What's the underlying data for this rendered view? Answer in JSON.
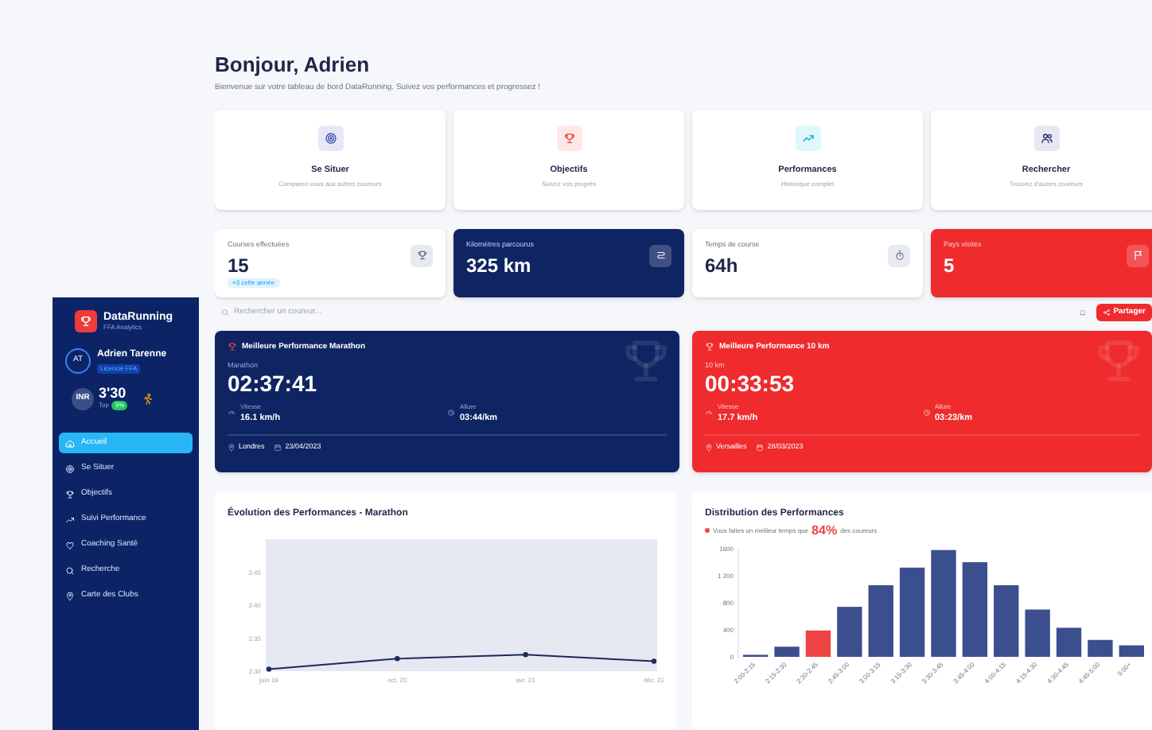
{
  "sidebar": {
    "brand": "DataRunning",
    "brand_sub": "FFA Analytics",
    "user": {
      "initials": "AT",
      "name": "Adrien Tarenne",
      "badge": "Licencié FFA"
    },
    "rating": {
      "label": "INR",
      "value": "3'30",
      "rank_label": "Top",
      "rank": "5%"
    },
    "items": [
      {
        "label": "Accueil",
        "selected": true
      },
      {
        "label": "Se Situer",
        "selected": false
      },
      {
        "label": "Objectifs",
        "selected": false
      },
      {
        "label": "Suivi Performance",
        "selected": false
      },
      {
        "label": "Coaching Santé",
        "selected": false
      },
      {
        "label": "Recherche",
        "selected": false
      },
      {
        "label": "Carte des Clubs",
        "selected": false
      }
    ]
  },
  "header": {
    "title": "Bonjour, Adrien",
    "subtitle": "Bienvenue sur votre tableau de bord DataRunning. Suivez vos performances et progressez !"
  },
  "features": [
    {
      "title": "Se Situer",
      "subtitle": "Comparez-vous aux autres coureurs"
    },
    {
      "title": "Objectifs",
      "subtitle": "Suivez vos progrès"
    },
    {
      "title": "Performances",
      "subtitle": "Historique complet"
    },
    {
      "title": "Rechercher",
      "subtitle": "Trouvez d'autres coureurs"
    }
  ],
  "stats": [
    {
      "kind": "light",
      "label": "Courses effectuées",
      "value": "15",
      "badge": "+3 cette année"
    },
    {
      "kind": "navy",
      "label": "Kilomètres parcourus",
      "value": "325 km"
    },
    {
      "kind": "light",
      "label": "Temps de course",
      "value": "64h"
    },
    {
      "kind": "red",
      "label": "Pays visités",
      "value": "5"
    }
  ],
  "search": {
    "placeholder": "Rechercher un coureur...",
    "share_button": "Partager"
  },
  "records": [
    {
      "kind": "navy",
      "title": "Meilleure Performance Marathon",
      "distance": "Marathon",
      "time": "02:37:41",
      "speed_label": "Vitesse",
      "speed": "16.1 km/h",
      "pace_label": "Allure",
      "pace": "03:44/km",
      "place": "Londres",
      "date": "23/04/2023"
    },
    {
      "kind": "red",
      "title": "Meilleure Performance 10 km",
      "distance": "10 km",
      "time": "00:33:53",
      "speed_label": "Vitesse",
      "speed": "17.7 km/h",
      "pace_label": "Allure",
      "pace": "03:23/km",
      "place": "Versailles",
      "date": "28/03/2023"
    }
  ],
  "evolution": {
    "chart_data": {
      "type": "line",
      "title": "Évolution des Performances - Marathon",
      "categories": [
        "juin 19",
        "oct. 20",
        "avr. 21",
        "déc. 22"
      ],
      "series": [
        {
          "color": "#1e2a5a",
          "marker": true,
          "values": [
            150.3,
            151.9,
            152.5,
            151.5
          ]
        }
      ],
      "yticks": [
        {
          "value": 150,
          "label": "2:30"
        },
        {
          "value": 155,
          "label": "2:35"
        },
        {
          "value": 160,
          "label": "2:40"
        },
        {
          "value": 165,
          "label": "2:45"
        }
      ],
      "ylim": [
        150,
        170
      ]
    }
  },
  "distribution": {
    "note_before": "Vous faites un meilleur temps que",
    "note_value": "84%",
    "note_after": "des coureurs",
    "chart_data": {
      "type": "bar",
      "title": "Distribution des Performances",
      "categories": [
        "2:00-2:15",
        "2:15-2:30",
        "2:30-2:45",
        "2:45-3:00",
        "3:00-3:15",
        "3:15-3:30",
        "3:30-3:45",
        "3:45-4:00",
        "4:00-4:15",
        "4:15-4:30",
        "4:30-4:45",
        "4:45-5:00",
        "5:00+"
      ],
      "series": [
        {
          "color": "#3b4f8f",
          "values": [
            30,
            150,
            null,
            740,
            1060,
            1320,
            1580,
            1400,
            1060,
            700,
            430,
            250,
            170
          ]
        },
        {
          "color": "#ef4444",
          "values": [
            null,
            null,
            390,
            null,
            null,
            null,
            null,
            null,
            null,
            null,
            null,
            null,
            null
          ]
        }
      ],
      "yticks": [
        {
          "value": 0,
          "label": "0"
        },
        {
          "value": 400,
          "label": "400"
        },
        {
          "value": 800,
          "label": "800"
        },
        {
          "value": 1200,
          "label": "1 200"
        },
        {
          "value": 1600,
          "label": "1600"
        }
      ],
      "ylim": [
        0,
        1600
      ]
    }
  }
}
